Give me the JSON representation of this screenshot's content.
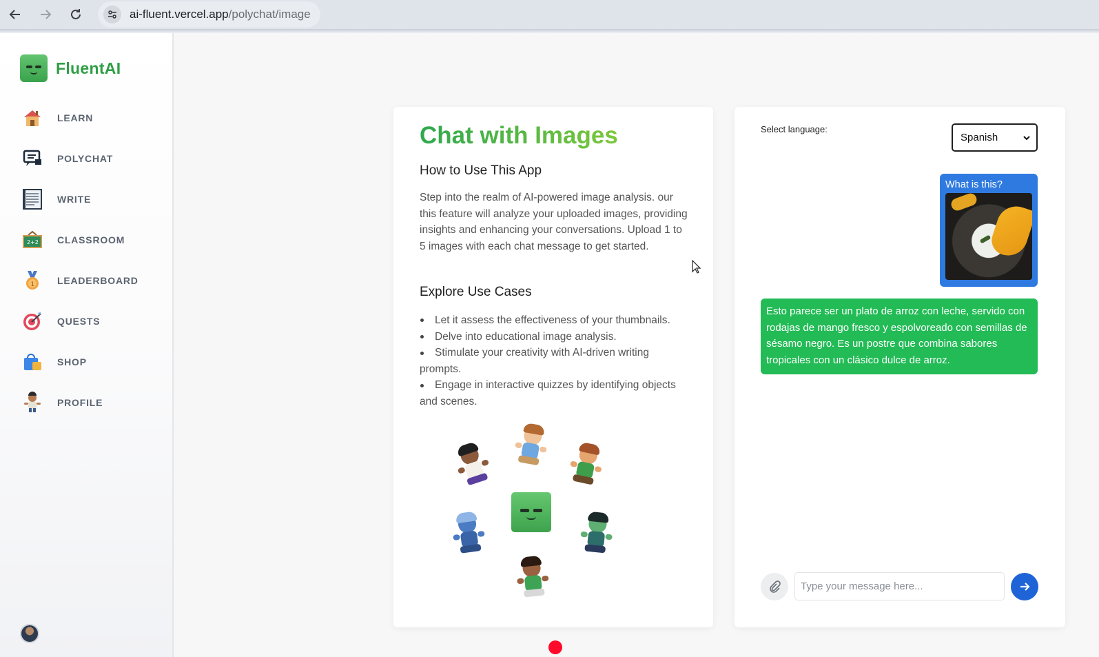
{
  "browser": {
    "url_host": "ai-fluent.vercel.app",
    "url_path": "/polychat/image"
  },
  "brand": {
    "name": "FluentAI"
  },
  "sidebar": {
    "items": [
      {
        "label": "LEARN",
        "icon": "house-icon"
      },
      {
        "label": "POLYCHAT",
        "icon": "chat-icon"
      },
      {
        "label": "WRITE",
        "icon": "notebook-icon"
      },
      {
        "label": "CLASSROOM",
        "icon": "chalkboard-icon"
      },
      {
        "label": "LEADERBOARD",
        "icon": "medal-icon"
      },
      {
        "label": "QUESTS",
        "icon": "target-icon"
      },
      {
        "label": "SHOP",
        "icon": "shopping-bag-icon"
      },
      {
        "label": "PROFILE",
        "icon": "profile-character-icon"
      }
    ]
  },
  "info": {
    "title": "Chat with Images",
    "how_heading": "How to Use This App",
    "description": "Step into the realm of AI-powered image analysis. our this feature will analyze your uploaded images, providing insights and enhancing your conversations. Upload 1 to 5 images with each chat message to get started.",
    "explore_heading": "Explore Use Cases",
    "use_cases": [
      "Let it assess the effectiveness of your thumbnails.",
      "Delve into educational image analysis.",
      "Stimulate your creativity with AI-driven writing prompts.",
      "Engage in interactive quizzes by identifying objects and scenes."
    ]
  },
  "chat": {
    "language_label": "Select language:",
    "selected_language": "Spanish",
    "user_message": "What is this?",
    "bot_message": "Esto parece ser un plato de arroz con leche, servido con rodajas de mango fresco y espolvoreado con semillas de sésamo negro. Es un postre que combina sabores tropicales con un clásico dulce de arroz.",
    "input_placeholder": "Type your message here...",
    "input_value": ""
  },
  "colors": {
    "brand_green": "#2f9e44",
    "user_bubble": "#2f7ae0",
    "bot_bubble": "#22bb55",
    "send_button": "#1f64d6"
  }
}
